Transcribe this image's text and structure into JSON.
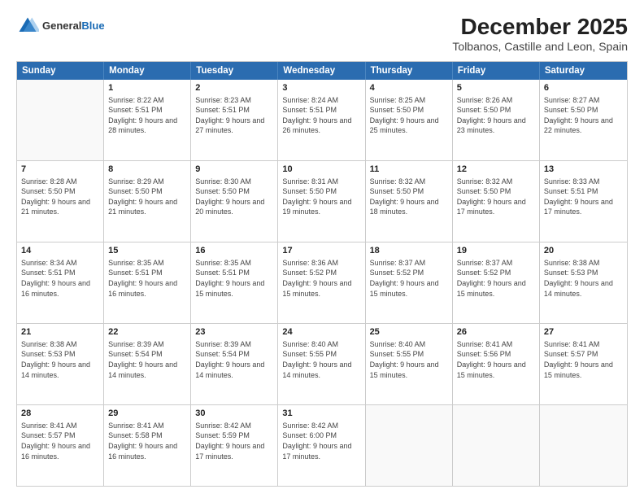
{
  "header": {
    "logo_general": "General",
    "logo_blue": "Blue",
    "main_title": "December 2025",
    "subtitle": "Tolbanos, Castille and Leon, Spain"
  },
  "calendar": {
    "days_of_week": [
      "Sunday",
      "Monday",
      "Tuesday",
      "Wednesday",
      "Thursday",
      "Friday",
      "Saturday"
    ],
    "weeks": [
      [
        {
          "day": "",
          "empty": true
        },
        {
          "day": "1",
          "sunrise": "8:22 AM",
          "sunset": "5:51 PM",
          "daylight": "9 hours and 28 minutes."
        },
        {
          "day": "2",
          "sunrise": "8:23 AM",
          "sunset": "5:51 PM",
          "daylight": "9 hours and 27 minutes."
        },
        {
          "day": "3",
          "sunrise": "8:24 AM",
          "sunset": "5:51 PM",
          "daylight": "9 hours and 26 minutes."
        },
        {
          "day": "4",
          "sunrise": "8:25 AM",
          "sunset": "5:50 PM",
          "daylight": "9 hours and 25 minutes."
        },
        {
          "day": "5",
          "sunrise": "8:26 AM",
          "sunset": "5:50 PM",
          "daylight": "9 hours and 23 minutes."
        },
        {
          "day": "6",
          "sunrise": "8:27 AM",
          "sunset": "5:50 PM",
          "daylight": "9 hours and 22 minutes."
        }
      ],
      [
        {
          "day": "7",
          "sunrise": "8:28 AM",
          "sunset": "5:50 PM",
          "daylight": "9 hours and 21 minutes."
        },
        {
          "day": "8",
          "sunrise": "8:29 AM",
          "sunset": "5:50 PM",
          "daylight": "9 hours and 21 minutes."
        },
        {
          "day": "9",
          "sunrise": "8:30 AM",
          "sunset": "5:50 PM",
          "daylight": "9 hours and 20 minutes."
        },
        {
          "day": "10",
          "sunrise": "8:31 AM",
          "sunset": "5:50 PM",
          "daylight": "9 hours and 19 minutes."
        },
        {
          "day": "11",
          "sunrise": "8:32 AM",
          "sunset": "5:50 PM",
          "daylight": "9 hours and 18 minutes."
        },
        {
          "day": "12",
          "sunrise": "8:32 AM",
          "sunset": "5:50 PM",
          "daylight": "9 hours and 17 minutes."
        },
        {
          "day": "13",
          "sunrise": "8:33 AM",
          "sunset": "5:51 PM",
          "daylight": "9 hours and 17 minutes."
        }
      ],
      [
        {
          "day": "14",
          "sunrise": "8:34 AM",
          "sunset": "5:51 PM",
          "daylight": "9 hours and 16 minutes."
        },
        {
          "day": "15",
          "sunrise": "8:35 AM",
          "sunset": "5:51 PM",
          "daylight": "9 hours and 16 minutes."
        },
        {
          "day": "16",
          "sunrise": "8:35 AM",
          "sunset": "5:51 PM",
          "daylight": "9 hours and 15 minutes."
        },
        {
          "day": "17",
          "sunrise": "8:36 AM",
          "sunset": "5:52 PM",
          "daylight": "9 hours and 15 minutes."
        },
        {
          "day": "18",
          "sunrise": "8:37 AM",
          "sunset": "5:52 PM",
          "daylight": "9 hours and 15 minutes."
        },
        {
          "day": "19",
          "sunrise": "8:37 AM",
          "sunset": "5:52 PM",
          "daylight": "9 hours and 15 minutes."
        },
        {
          "day": "20",
          "sunrise": "8:38 AM",
          "sunset": "5:53 PM",
          "daylight": "9 hours and 14 minutes."
        }
      ],
      [
        {
          "day": "21",
          "sunrise": "8:38 AM",
          "sunset": "5:53 PM",
          "daylight": "9 hours and 14 minutes."
        },
        {
          "day": "22",
          "sunrise": "8:39 AM",
          "sunset": "5:54 PM",
          "daylight": "9 hours and 14 minutes."
        },
        {
          "day": "23",
          "sunrise": "8:39 AM",
          "sunset": "5:54 PM",
          "daylight": "9 hours and 14 minutes."
        },
        {
          "day": "24",
          "sunrise": "8:40 AM",
          "sunset": "5:55 PM",
          "daylight": "9 hours and 14 minutes."
        },
        {
          "day": "25",
          "sunrise": "8:40 AM",
          "sunset": "5:55 PM",
          "daylight": "9 hours and 15 minutes."
        },
        {
          "day": "26",
          "sunrise": "8:41 AM",
          "sunset": "5:56 PM",
          "daylight": "9 hours and 15 minutes."
        },
        {
          "day": "27",
          "sunrise": "8:41 AM",
          "sunset": "5:57 PM",
          "daylight": "9 hours and 15 minutes."
        }
      ],
      [
        {
          "day": "28",
          "sunrise": "8:41 AM",
          "sunset": "5:57 PM",
          "daylight": "9 hours and 16 minutes."
        },
        {
          "day": "29",
          "sunrise": "8:41 AM",
          "sunset": "5:58 PM",
          "daylight": "9 hours and 16 minutes."
        },
        {
          "day": "30",
          "sunrise": "8:42 AM",
          "sunset": "5:59 PM",
          "daylight": "9 hours and 17 minutes."
        },
        {
          "day": "31",
          "sunrise": "8:42 AM",
          "sunset": "6:00 PM",
          "daylight": "9 hours and 17 minutes."
        },
        {
          "day": "",
          "empty": true
        },
        {
          "day": "",
          "empty": true
        },
        {
          "day": "",
          "empty": true
        }
      ]
    ]
  }
}
